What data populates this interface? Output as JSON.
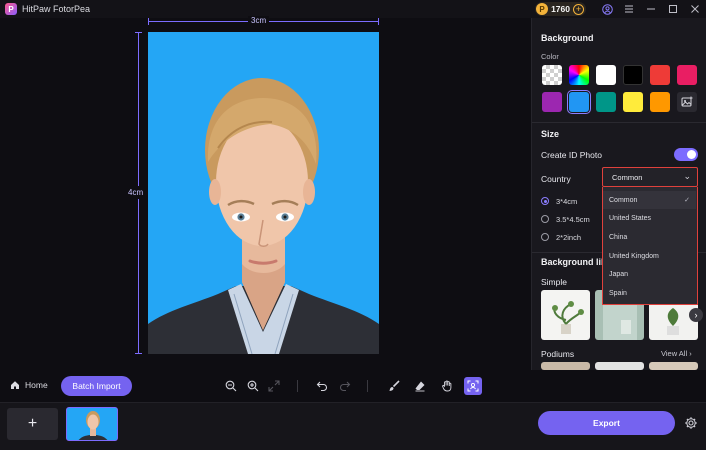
{
  "app": {
    "title": "HitPaw FotorPea",
    "logo_letter": "P",
    "credits": "1760",
    "credit_add": "+"
  },
  "canvas": {
    "width_label": "3cm",
    "height_label": "4cm",
    "photo_background": "#24a6f5"
  },
  "panel": {
    "background_title": "Background",
    "color_label": "Color",
    "swatches": [
      "transparent",
      "rainbow",
      "#ffffff",
      "#000000",
      "#ee3b37",
      "#e91e63",
      "#9c27b0",
      "#2196f3",
      "#009688",
      "#ffeb3b",
      "#ff9800",
      "upload"
    ],
    "size_title": "Size",
    "create_id_label": "Create ID Photo",
    "country_label": "Country",
    "country_value": "Common",
    "sizes": [
      {
        "label": "3*4cm",
        "selected": true
      },
      {
        "label": "3.5*4.5cm",
        "selected": false
      },
      {
        "label": "2*2inch",
        "selected": false
      }
    ],
    "library_title": "Background lib",
    "simple_label": "Simple",
    "podiums_label": "Podiums",
    "view_all": "View All"
  },
  "dropdown": {
    "items": [
      "Common",
      "United States",
      "China",
      "United Kingdom",
      "Japan",
      "Spain"
    ],
    "selected": "Common"
  },
  "toolbar": {
    "home_label": "Home",
    "batch_import_label": "Batch Import"
  },
  "footer": {
    "add_label": "+",
    "export_label": "Export"
  },
  "colors": {
    "accent": "#7563f0",
    "highlight_border": "#e0413c",
    "panel_bg": "#19181e",
    "canvas_bg": "#0e0d12"
  }
}
